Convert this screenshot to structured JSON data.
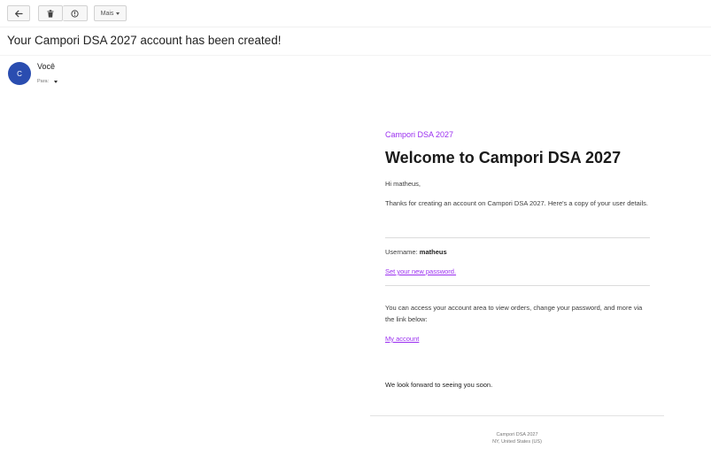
{
  "toolbar": {
    "back_icon": "arrow-left-icon",
    "delete_icon": "trash-icon",
    "info_icon": "info-icon",
    "more_label": "Mais"
  },
  "message": {
    "subject": "Your Campori DSA 2027 account has been created!",
    "sender": {
      "avatar_letter": "C",
      "name": "Você",
      "to_label": "Para:"
    }
  },
  "email": {
    "brand": "Campori DSA 2027",
    "heading": "Welcome to Campori DSA 2027",
    "greeting": "Hi matheus,",
    "thanks": "Thanks for creating an account on Campori DSA 2027. Here's a copy of your user details.",
    "username_label": "Username:",
    "username_value": "matheus",
    "set_password_link": "Set your new password.",
    "access_text": "You can access your account area to view orders, change your password, and more via the link below:",
    "my_account_link": "My account",
    "closing": "We look forward to seeing you soon.",
    "footer_line1": "Campori DSA 2027",
    "footer_line2": "NY, United States (US)"
  },
  "colors": {
    "brand_purple": "#9b2ff0",
    "avatar_blue": "#2a4db0"
  }
}
